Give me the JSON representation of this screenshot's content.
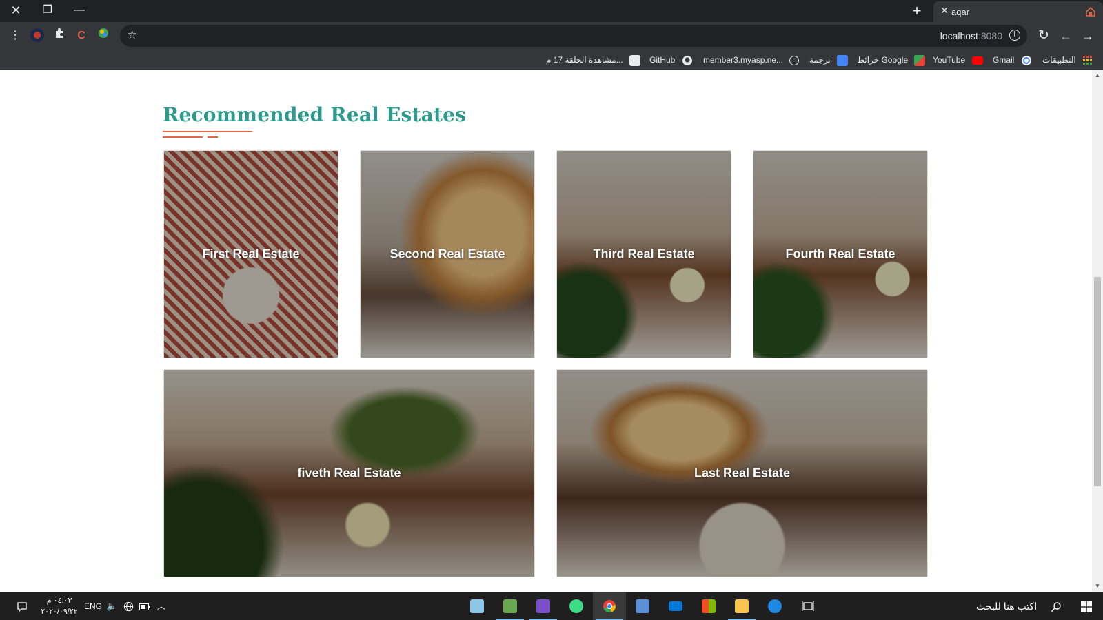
{
  "window": {
    "close": "✕",
    "restore": "❐",
    "minimize": "—"
  },
  "tabbar": {
    "new_tab": "+",
    "tab": {
      "title": "aqar",
      "close": "✕"
    }
  },
  "toolbar": {
    "menu": "⋮",
    "url_host": "localhost",
    "url_port": ":8080",
    "info": "i",
    "reload": "↻",
    "back": "←",
    "forward": "→",
    "star": "☆"
  },
  "bookmarks": {
    "apps": "التطبيقات",
    "gmail": "Gmail",
    "youtube": "YouTube",
    "maps": "خرائط Google",
    "translate": "ترجمة",
    "member": "member3.myasp.ne...",
    "github": "GitHub",
    "episode": "مشاهدة الحلقة 17 م..."
  },
  "section": {
    "title": "Recommended Real Estates"
  },
  "cards": [
    {
      "label": "First Real Estate"
    },
    {
      "label": "Second Real Estate"
    },
    {
      "label": "Third Real Estate"
    },
    {
      "label": "Fourth Real Estate"
    },
    {
      "label": "fiveth Real Estate"
    },
    {
      "label": "Last Real Estate"
    }
  ],
  "taskbar": {
    "time": "٠٤:٠٣ م",
    "date": "٢٠٢٠/٠٩/٢٢",
    "lang": "ENG",
    "search_placeholder": "اكتب هنا للبحث"
  },
  "colors": {
    "accent_title": "#2e9a8c",
    "accent_line": "#e2674a",
    "chrome_dark": "#202124",
    "chrome_mid": "#35363a"
  }
}
